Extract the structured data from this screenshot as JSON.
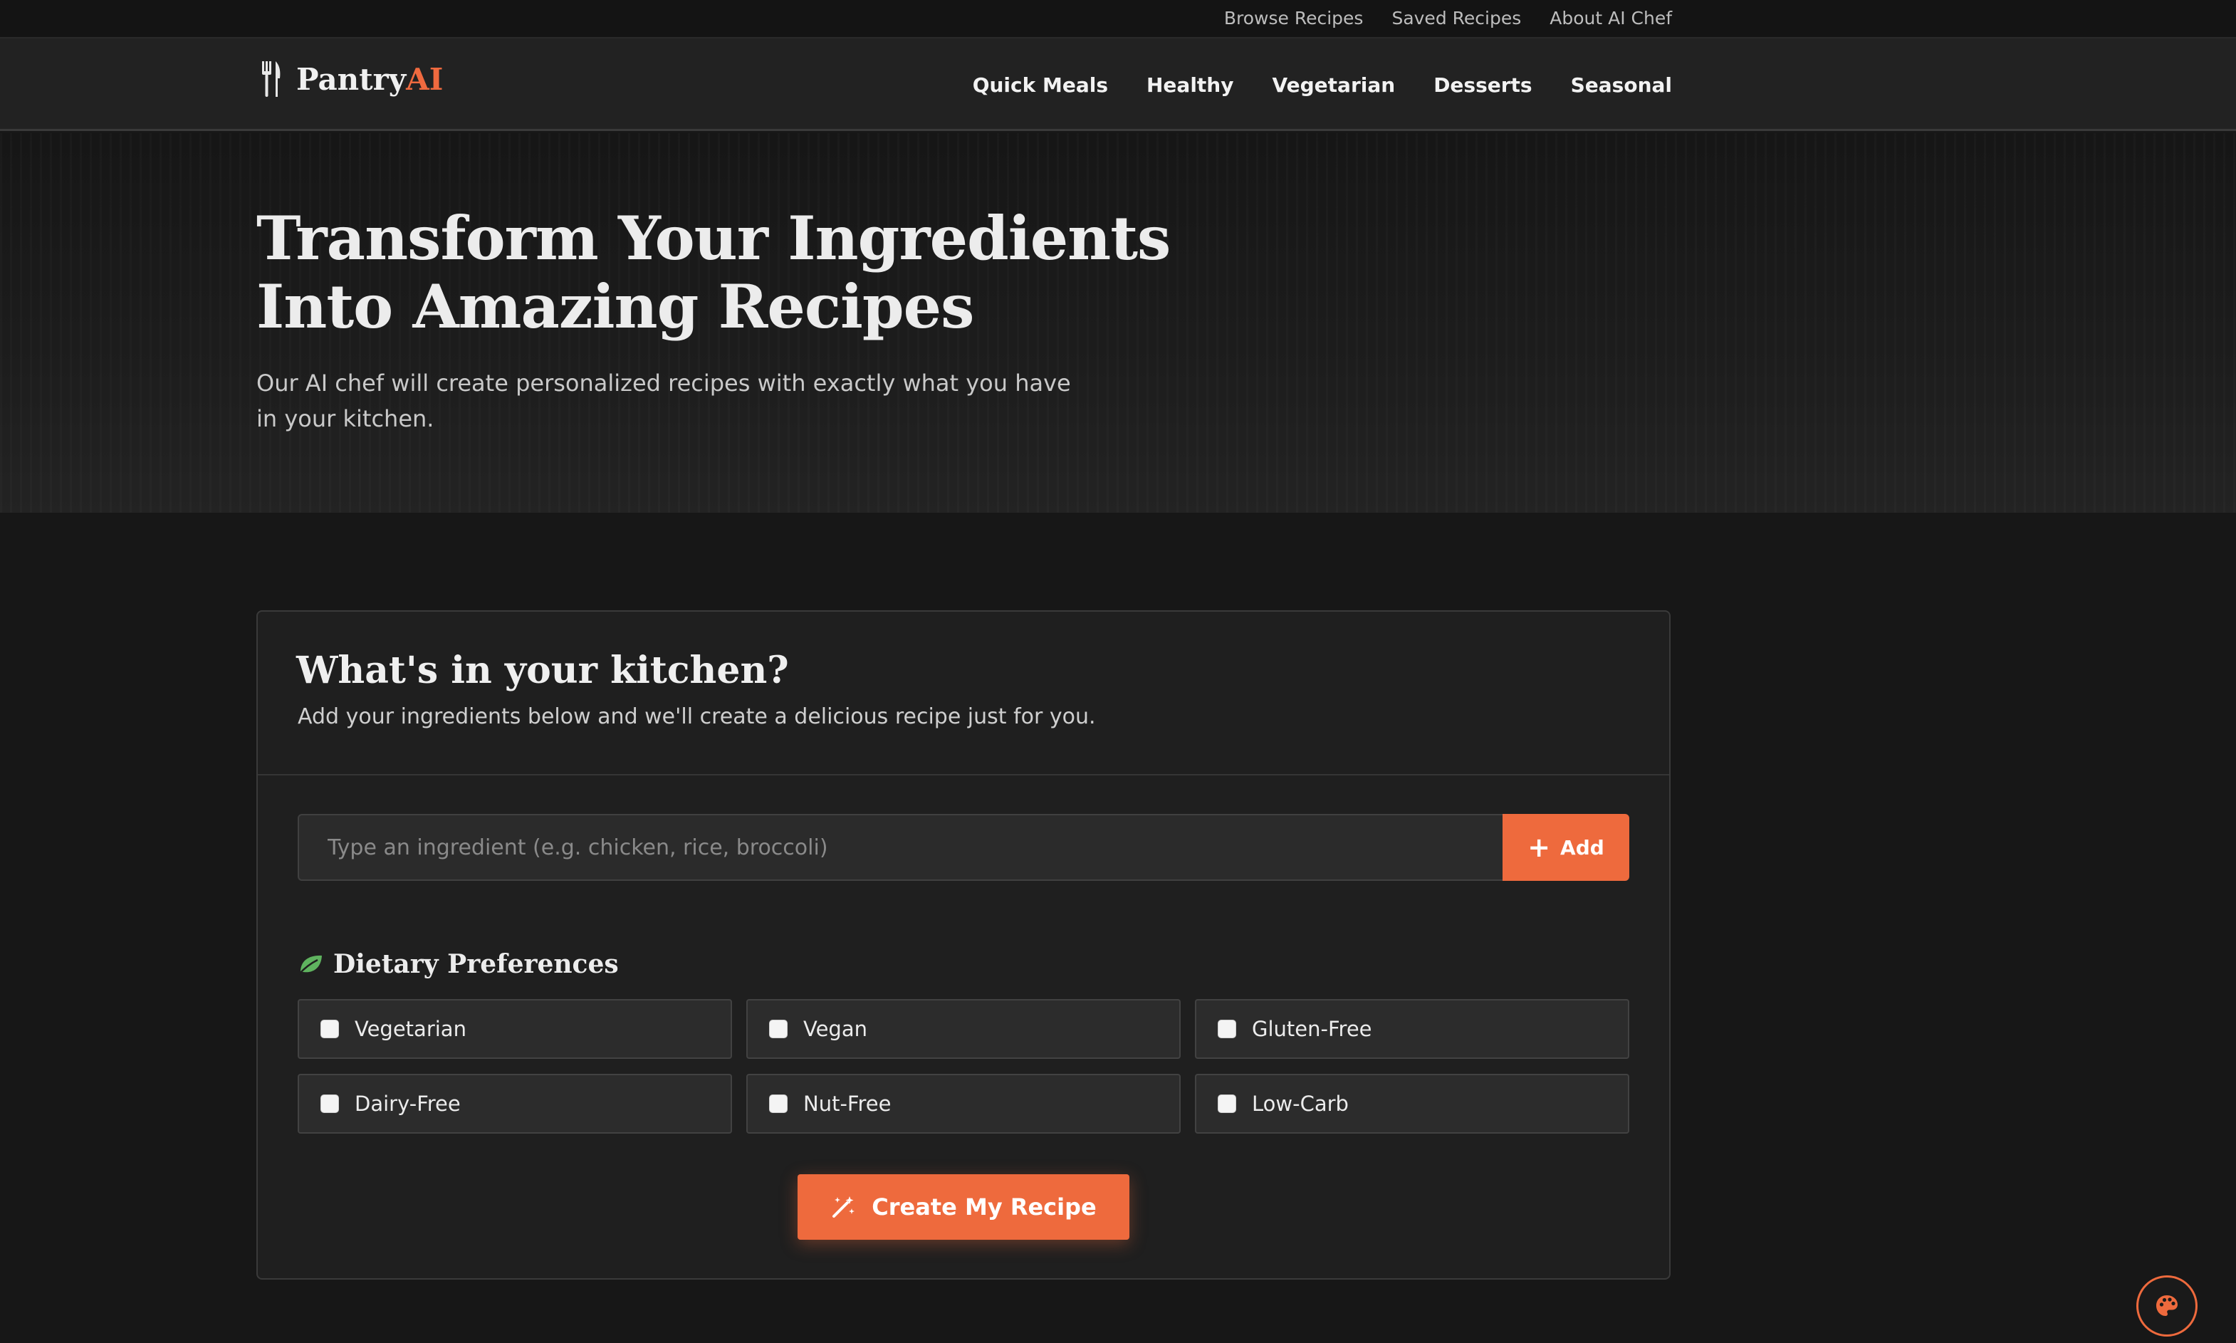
{
  "top_links": [
    "Browse Recipes",
    "Saved Recipes",
    "About AI Chef"
  ],
  "brand": {
    "name": "Pantry",
    "accent": "AI",
    "icon": "fork-knife-icon",
    "accent_color": "#f06a3f"
  },
  "nav": [
    "Quick Meals",
    "Healthy",
    "Vegetarian",
    "Desserts",
    "Seasonal"
  ],
  "hero": {
    "title": "Transform Your Ingredients Into Amazing Recipes",
    "subtitle": "Our AI chef will create personalized recipes with exactly what you have in your kitchen."
  },
  "kitchen": {
    "title": "What's in your kitchen?",
    "subtitle": "Add your ingredients below and we'll create a delicious recipe just for you.",
    "input_placeholder": "Type an ingredient (e.g. chicken, rice, broccoli)",
    "input_value": "",
    "add_label": "Add",
    "dietary_title": "Dietary Preferences",
    "dietary_icon": "leaf-icon",
    "dietary_options": [
      {
        "label": "Vegetarian",
        "checked": false
      },
      {
        "label": "Vegan",
        "checked": false
      },
      {
        "label": "Gluten-Free",
        "checked": false
      },
      {
        "label": "Dairy-Free",
        "checked": false
      },
      {
        "label": "Nut-Free",
        "checked": false
      },
      {
        "label": "Low-Carb",
        "checked": false
      }
    ],
    "create_label": "Create My Recipe",
    "create_icon": "magic-wand-icon"
  },
  "theme_button_icon": "palette-icon",
  "colors": {
    "accent": "#ee6a3d",
    "leaf": "#5fb35f",
    "background": "#171717"
  }
}
